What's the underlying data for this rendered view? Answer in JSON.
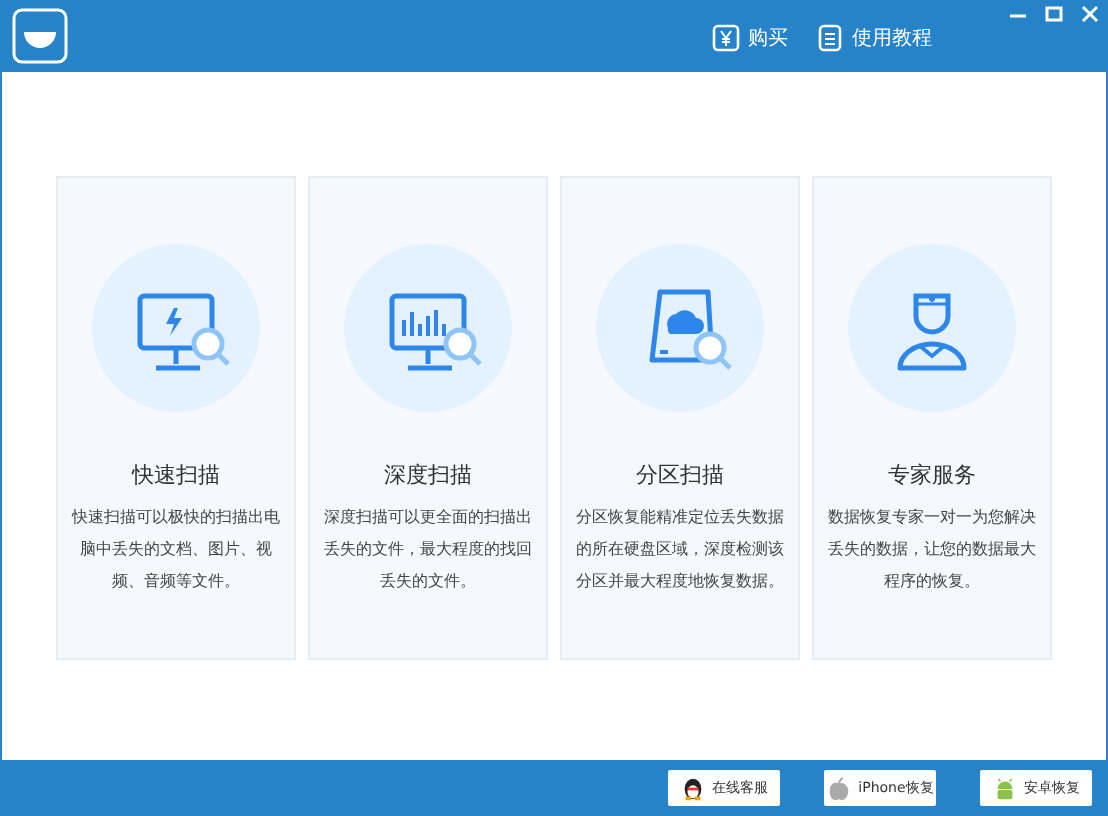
{
  "header": {
    "actions": [
      {
        "kind": "buy",
        "label": "购买"
      },
      {
        "kind": "guide",
        "label": "使用教程"
      }
    ]
  },
  "cards": [
    {
      "kind": "quick",
      "title": "快速扫描",
      "description": "快速扫描可以极快的扫描出电脑中丢失的文档、图片、视频、音频等文件。"
    },
    {
      "kind": "deep",
      "title": "深度扫描",
      "description": "深度扫描可以更全面的扫描出丢失的文件，最大程度的找回丢失的文件。"
    },
    {
      "kind": "partition",
      "title": "分区扫描",
      "description": "分区恢复能精准定位丢失数据的所在硬盘区域，深度检测该分区并最大程度地恢复数据。"
    },
    {
      "kind": "expert",
      "title": "专家服务",
      "description": "数据恢复专家一对一为您解决丢失的数据，让您的数据最大程序的恢复。"
    }
  ],
  "footer": {
    "buttons": [
      {
        "kind": "qq",
        "label": "在线客服"
      },
      {
        "kind": "iphone",
        "label": "iPhone恢复"
      },
      {
        "kind": "android",
        "label": "安卓恢复"
      }
    ]
  }
}
